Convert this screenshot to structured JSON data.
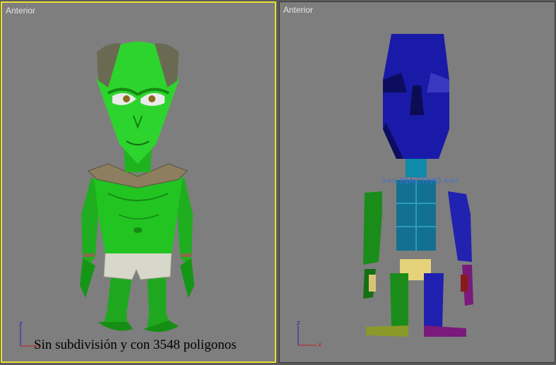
{
  "viewports": {
    "left": {
      "label": "Anterior",
      "active": true
    },
    "right": {
      "label": "Anterior",
      "active": false,
      "status": ">>> INACTIVO <<<"
    }
  },
  "caption": "Sin subdivisión y con 3548 poligonos",
  "axis": {
    "vertical": "z",
    "horizontal": "x"
  },
  "colors": {
    "active_border": "#e8e036",
    "viewport_bg": "#7e7e7e",
    "alien_skin": "#22c422",
    "mannequin_head": "#1c1ca0"
  },
  "icons": {
    "alien": "alien-character-render",
    "mannequin": "low-poly-mannequin",
    "axis": "xyz-axis-gizmo"
  }
}
